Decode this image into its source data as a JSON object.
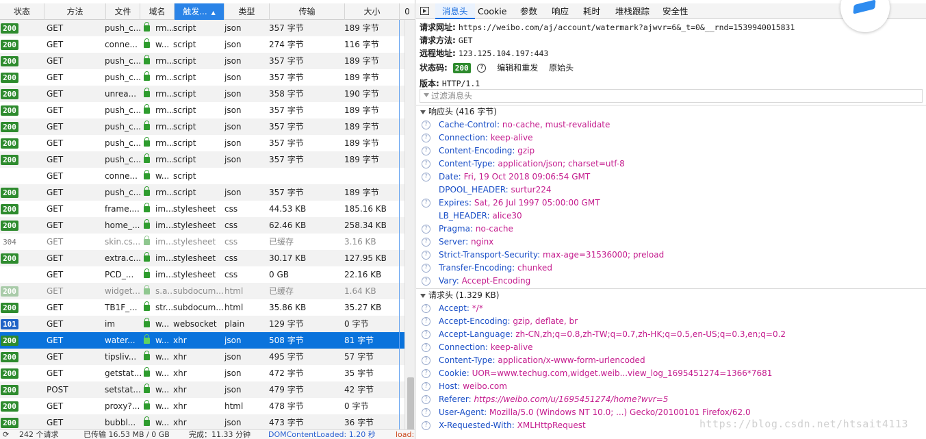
{
  "network_table": {
    "columns": [
      {
        "label": "状态",
        "width": 65
      },
      {
        "label": "方法",
        "width": 90
      },
      {
        "label": "文件",
        "width": 50
      },
      {
        "label": "域名",
        "width": 50
      },
      {
        "label": "触发...",
        "width": 73,
        "sorted": true,
        "sort_arrow": "▲"
      },
      {
        "label": "类型",
        "width": 66
      },
      {
        "label": "传输",
        "width": 110
      },
      {
        "label": "大小",
        "width": 80
      },
      {
        "label": "0",
        "width": 23
      }
    ],
    "rows": [
      {
        "status": "200",
        "method": "GET",
        "file": "push_c...",
        "domain": "rm...",
        "cause": "script",
        "type": "json",
        "transfer": "357 字节",
        "size": "189 字节"
      },
      {
        "status": "200",
        "method": "GET",
        "file": "conne...",
        "domain": "w...",
        "cause": "script",
        "type": "json",
        "transfer": "274 字节",
        "size": "116 字节"
      },
      {
        "status": "200",
        "method": "GET",
        "file": "push_c...",
        "domain": "rm...",
        "cause": "script",
        "type": "json",
        "transfer": "357 字节",
        "size": "189 字节"
      },
      {
        "status": "200",
        "method": "GET",
        "file": "push_c...",
        "domain": "rm...",
        "cause": "script",
        "type": "json",
        "transfer": "357 字节",
        "size": "189 字节"
      },
      {
        "status": "200",
        "method": "GET",
        "file": "unrea...",
        "domain": "rm...",
        "cause": "script",
        "type": "json",
        "transfer": "358 字节",
        "size": "190 字节"
      },
      {
        "status": "200",
        "method": "GET",
        "file": "push_c...",
        "domain": "rm...",
        "cause": "script",
        "type": "json",
        "transfer": "357 字节",
        "size": "189 字节"
      },
      {
        "status": "200",
        "method": "GET",
        "file": "push_c...",
        "domain": "rm...",
        "cause": "script",
        "type": "json",
        "transfer": "357 字节",
        "size": "189 字节"
      },
      {
        "status": "200",
        "method": "GET",
        "file": "push_c...",
        "domain": "rm...",
        "cause": "script",
        "type": "json",
        "transfer": "357 字节",
        "size": "189 字节"
      },
      {
        "status": "200",
        "method": "GET",
        "file": "push_c...",
        "domain": "rm...",
        "cause": "script",
        "type": "json",
        "transfer": "357 字节",
        "size": "189 字节"
      },
      {
        "status": "",
        "method": "GET",
        "file": "conne...",
        "domain": "w...",
        "cause": "script",
        "type": "",
        "transfer": "",
        "size": ""
      },
      {
        "status": "200",
        "method": "GET",
        "file": "push_c...",
        "domain": "rm...",
        "cause": "script",
        "type": "json",
        "transfer": "357 字节",
        "size": "189 字节"
      },
      {
        "status": "200",
        "method": "GET",
        "file": "frame....",
        "domain": "im...",
        "cause": "stylesheet",
        "type": "css",
        "transfer": "44.53 KB",
        "size": "185.16 KB"
      },
      {
        "status": "200",
        "method": "GET",
        "file": "home_...",
        "domain": "im...",
        "cause": "stylesheet",
        "type": "css",
        "transfer": "62.46 KB",
        "size": "258.34 KB"
      },
      {
        "status": "304",
        "method": "GET",
        "file": "skin.cs...",
        "domain": "im...",
        "cause": "stylesheet",
        "type": "css",
        "transfer": "已缓存",
        "size": "3.16 KB",
        "cached": true,
        "badge": "plain"
      },
      {
        "status": "200",
        "method": "GET",
        "file": "extra.c...",
        "domain": "im...",
        "cause": "stylesheet",
        "type": "css",
        "transfer": "30.17 KB",
        "size": "127.95 KB"
      },
      {
        "status": "",
        "method": "GET",
        "file": "PCD_...",
        "domain": "im...",
        "cause": "stylesheet",
        "type": "css",
        "transfer": "0 GB",
        "size": "22.16 KB"
      },
      {
        "status": "200",
        "method": "GET",
        "file": "widget...",
        "domain": "s.a...",
        "cause": "subdocum...",
        "type": "html",
        "transfer": "已缓存",
        "size": "1.64 KB",
        "cached": true,
        "badge": "faded"
      },
      {
        "status": "200",
        "method": "GET",
        "file": "TB1F_...",
        "domain": "str...",
        "cause": "subdocum...",
        "type": "html",
        "transfer": "35.86 KB",
        "size": "35.27 KB"
      },
      {
        "status": "101",
        "method": "GET",
        "file": "im",
        "domain": "w...",
        "cause": "websocket",
        "type": "plain",
        "transfer": "129 字节",
        "size": "0 字节",
        "badge": "info"
      },
      {
        "status": "200",
        "method": "GET",
        "file": "water...",
        "domain": "w...",
        "cause": "xhr",
        "type": "json",
        "transfer": "508 字节",
        "size": "81 字节",
        "selected": true
      },
      {
        "status": "200",
        "method": "GET",
        "file": "tipsliv...",
        "domain": "w...",
        "cause": "xhr",
        "type": "json",
        "transfer": "495 字节",
        "size": "57 字节"
      },
      {
        "status": "200",
        "method": "GET",
        "file": "getstat...",
        "domain": "w...",
        "cause": "xhr",
        "type": "json",
        "transfer": "472 字节",
        "size": "35 字节"
      },
      {
        "status": "200",
        "method": "POST",
        "file": "setstat...",
        "domain": "w...",
        "cause": "xhr",
        "type": "json",
        "transfer": "479 字节",
        "size": "42 字节"
      },
      {
        "status": "200",
        "method": "GET",
        "file": "proxy?...",
        "domain": "w...",
        "cause": "xhr",
        "type": "html",
        "transfer": "478 字节",
        "size": "0 字节"
      },
      {
        "status": "200",
        "method": "GET",
        "file": "bubbl...",
        "domain": "w...",
        "cause": "xhr",
        "type": "json",
        "transfer": "473 字节",
        "size": "36 字节"
      }
    ]
  },
  "statusbar": {
    "requests": "242 个请求",
    "transferred": "已传输 16.53 MB / 0 GB",
    "finish": "完成：11.33 分钟",
    "dom": "DOMContentLoaded: 1.20 秒",
    "load": "load:"
  },
  "detail": {
    "tabs": [
      "消息头",
      "Cookie",
      "参数",
      "响应",
      "耗时",
      "堆栈跟踪",
      "安全性"
    ],
    "request_url_label": "请求网址:",
    "request_url": "https://weibo.com/aj/account/watermark?ajwvr=6&_t=0&__rnd=1539940015831",
    "method_label": "请求方法:",
    "method": "GET",
    "remote_label": "远程地址:",
    "remote": "123.125.104.197:443",
    "status_label": "状态码:",
    "status": "200",
    "edit_resend": "编辑和重发",
    "raw_headers": "原始头",
    "version_label": "版本:",
    "version": "HTTP/1.1",
    "filter_placeholder": "过滤消息头",
    "response_section": "响应头 (416 字节)",
    "response_headers": [
      {
        "name": "Cache-Control:",
        "value": "no-cache, must-revalidate",
        "help": true
      },
      {
        "name": "Connection:",
        "value": "keep-alive",
        "help": true
      },
      {
        "name": "Content-Encoding:",
        "value": "gzip",
        "help": true
      },
      {
        "name": "Content-Type:",
        "value": "application/json; charset=utf-8",
        "help": true
      },
      {
        "name": "Date:",
        "value": "Fri, 19 Oct 2018 09:06:54 GMT",
        "help": true
      },
      {
        "name": "DPOOL_HEADER:",
        "value": "surtur224",
        "help": false
      },
      {
        "name": "Expires:",
        "value": "Sat, 26 Jul 1997 05:00:00 GMT",
        "help": true
      },
      {
        "name": "LB_HEADER:",
        "value": "alice30",
        "help": false
      },
      {
        "name": "Pragma:",
        "value": "no-cache",
        "help": true
      },
      {
        "name": "Server:",
        "value": "nginx",
        "help": true
      },
      {
        "name": "Strict-Transport-Security:",
        "value": "max-age=31536000; preload",
        "help": true
      },
      {
        "name": "Transfer-Encoding:",
        "value": "chunked",
        "help": true
      },
      {
        "name": "Vary:",
        "value": "Accept-Encoding",
        "help": true
      }
    ],
    "request_section": "请求头 (1.329 KB)",
    "request_headers": [
      {
        "name": "Accept:",
        "value": "*/*",
        "help": true
      },
      {
        "name": "Accept-Encoding:",
        "value": "gzip, deflate, br",
        "help": true
      },
      {
        "name": "Accept-Language:",
        "value": "zh-CN,zh;q=0.8,zh-TW;q=0.7,zh-HK;q=0.5,en-US;q=0.3,en;q=0.2",
        "help": true
      },
      {
        "name": "Connection:",
        "value": "keep-alive",
        "help": true
      },
      {
        "name": "Content-Type:",
        "value": "application/x-www-form-urlencoded",
        "help": true
      },
      {
        "name": "Cookie:",
        "value": "UOR=www.techug.com,widget.weib...view_log_1695451274=1366*7681",
        "help": true
      },
      {
        "name": "Host:",
        "value": "weibo.com",
        "help": true
      },
      {
        "name": "Referer:",
        "value": "https://weibo.com/u/1695451274/home?wvr=5",
        "help": true,
        "italic": true
      },
      {
        "name": "User-Agent:",
        "value": "Mozilla/5.0 (Windows NT 10.0; ...) Gecko/20100101 Firefox/62.0",
        "help": true
      },
      {
        "name": "X-Requested-With:",
        "value": "XMLHttpRequest",
        "help": true
      }
    ]
  },
  "watermark": "https://blog.csdn.net/htsait4113",
  "colors": {
    "accent": "#2a83e7",
    "selected_row": "#0a73dc",
    "status_ok": "#2e8b2e",
    "header_name": "#1a4fc7",
    "header_value": "#c41b8d"
  }
}
